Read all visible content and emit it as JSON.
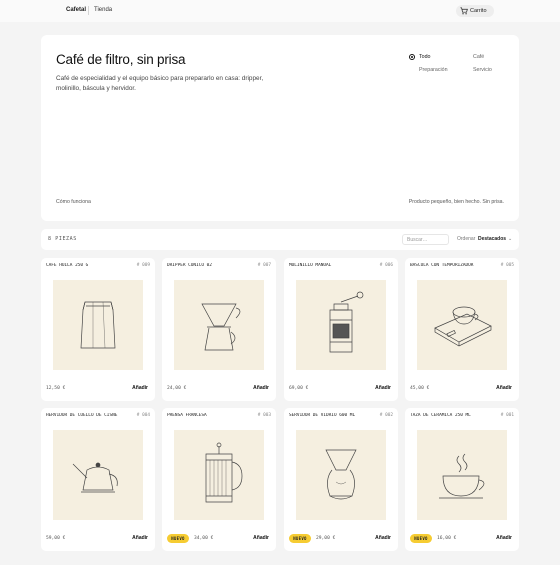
{
  "nav": {
    "brand": "Cafetal",
    "shop_link": "Tienda",
    "cart_label": "Carrito"
  },
  "hero": {
    "title": "Café de filtro, sin prisa",
    "description": "Café de especialidad y el equipo básico para prepararlo en casa: dripper, molinillo, báscula y hervidor.",
    "filters": [
      "Todo",
      "Café",
      "Preparación",
      "Servicio"
    ],
    "active_filter": "Todo",
    "how_link": "Cómo funciona",
    "slogan": "Producto pequeño, bien hecho. Sin prisa."
  },
  "toolbar": {
    "count": "8 PIEZAS",
    "search_placeholder": "Buscar…",
    "sort_label": "Ordenar",
    "sort_value": "Destacados"
  },
  "products": [
    {
      "name": "CAFÉ HUILA 250 G",
      "code": "# 009",
      "price": "12,50 €",
      "add": "Añadir",
      "badge": "",
      "icon": "coffee-bag-icon"
    },
    {
      "name": "DRIPPER CÓNICO 02",
      "code": "# 007",
      "price": "24,00 €",
      "add": "Añadir",
      "badge": "",
      "icon": "dripper-icon"
    },
    {
      "name": "MOLINILLO MANUAL",
      "code": "# 006",
      "price": "69,00 €",
      "add": "Añadir",
      "badge": "",
      "icon": "grinder-icon"
    },
    {
      "name": "BÁSCULA CON TEMPORIZADOR",
      "code": "# 005",
      "price": "45,00 €",
      "add": "Añadir",
      "badge": "",
      "icon": "scale-icon"
    },
    {
      "name": "HERVIDOR DE CUELLO DE CISNE",
      "code": "# 004",
      "price": "59,00 €",
      "add": "Añadir",
      "badge": "",
      "icon": "kettle-icon"
    },
    {
      "name": "PRENSA FRANCESA",
      "code": "# 003",
      "price": "34,00 €",
      "add": "Añadir",
      "badge": "NUEVO",
      "icon": "french-press-icon"
    },
    {
      "name": "SERVIDOR DE VIDRIO 600 ML",
      "code": "# 002",
      "price": "29,00 €",
      "add": "Añadir",
      "badge": "NUEVO",
      "icon": "glass-server-icon"
    },
    {
      "name": "TAZA DE CERÁMICA 250 ML",
      "code": "# 001",
      "price": "16,00 €",
      "add": "Añadir",
      "badge": "NUEVO",
      "icon": "cup-icon"
    }
  ],
  "colors": {
    "background": "#f4f4f4",
    "card": "#ffffff",
    "art_background": "#f5efe0",
    "badge": "#f6cc32",
    "text": "#1a1a1a"
  }
}
